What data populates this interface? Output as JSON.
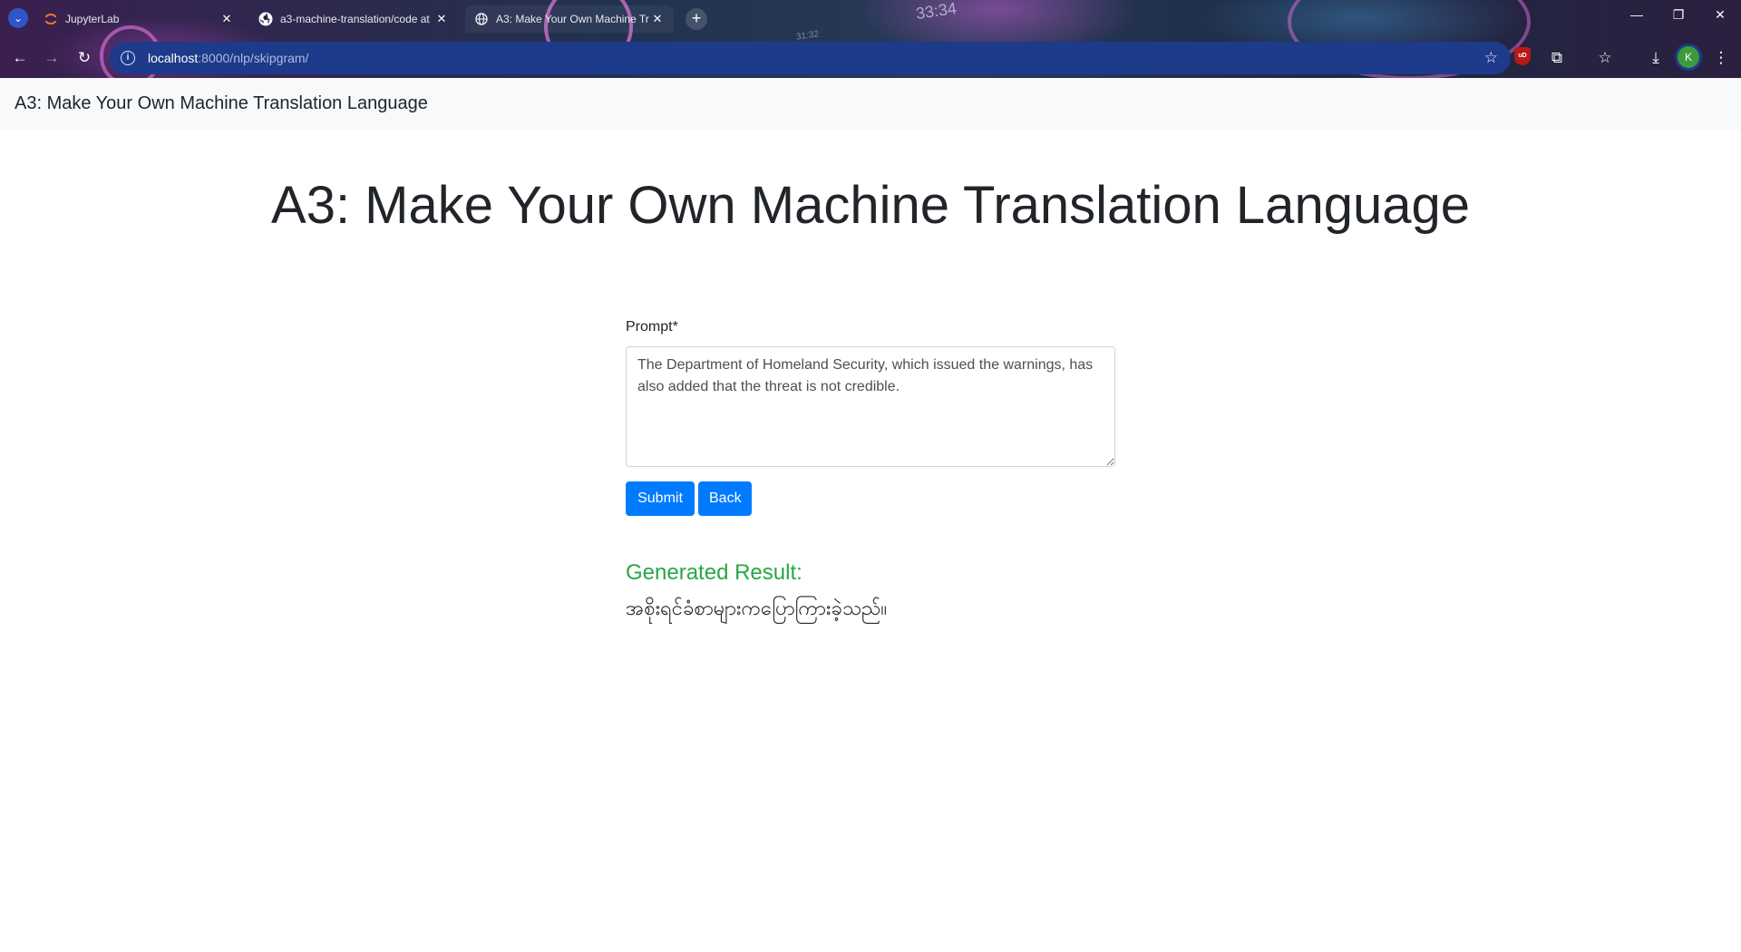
{
  "browser": {
    "tabs": [
      {
        "title": "JupyterLab",
        "icon": "jupyter-icon",
        "active": false
      },
      {
        "title": "a3-machine-translation/code at",
        "icon": "github-icon",
        "active": false
      },
      {
        "title": "A3: Make Your Own Machine Tr",
        "icon": "globe-icon",
        "active": true
      }
    ],
    "url_host": "localhost",
    "url_path": ":8000/nlp/skipgram/",
    "profile_initial": "K",
    "ublock_label": "uD",
    "wallpaper_clock": "33:34",
    "wallpaper_clock_small": "31:32"
  },
  "page": {
    "navbar_brand": "A3: Make Your Own Machine Translation Language",
    "heading": "A3: Make Your Own Machine Translation Language",
    "prompt_label": "Prompt*",
    "prompt_value": "The Department of Homeland Security, which issued the warnings, has also added that the threat is not credible.",
    "submit_label": "Submit",
    "back_label": "Back",
    "result_title": "Generated Result:",
    "result_text": "အစိုးရင်ခံစာများကပြောကြားခဲ့သည်။"
  },
  "colors": {
    "primary": "#007bff",
    "success": "#28a745",
    "omnibox": "#1e3a8a",
    "navbar_bg": "#f8f9fa"
  }
}
